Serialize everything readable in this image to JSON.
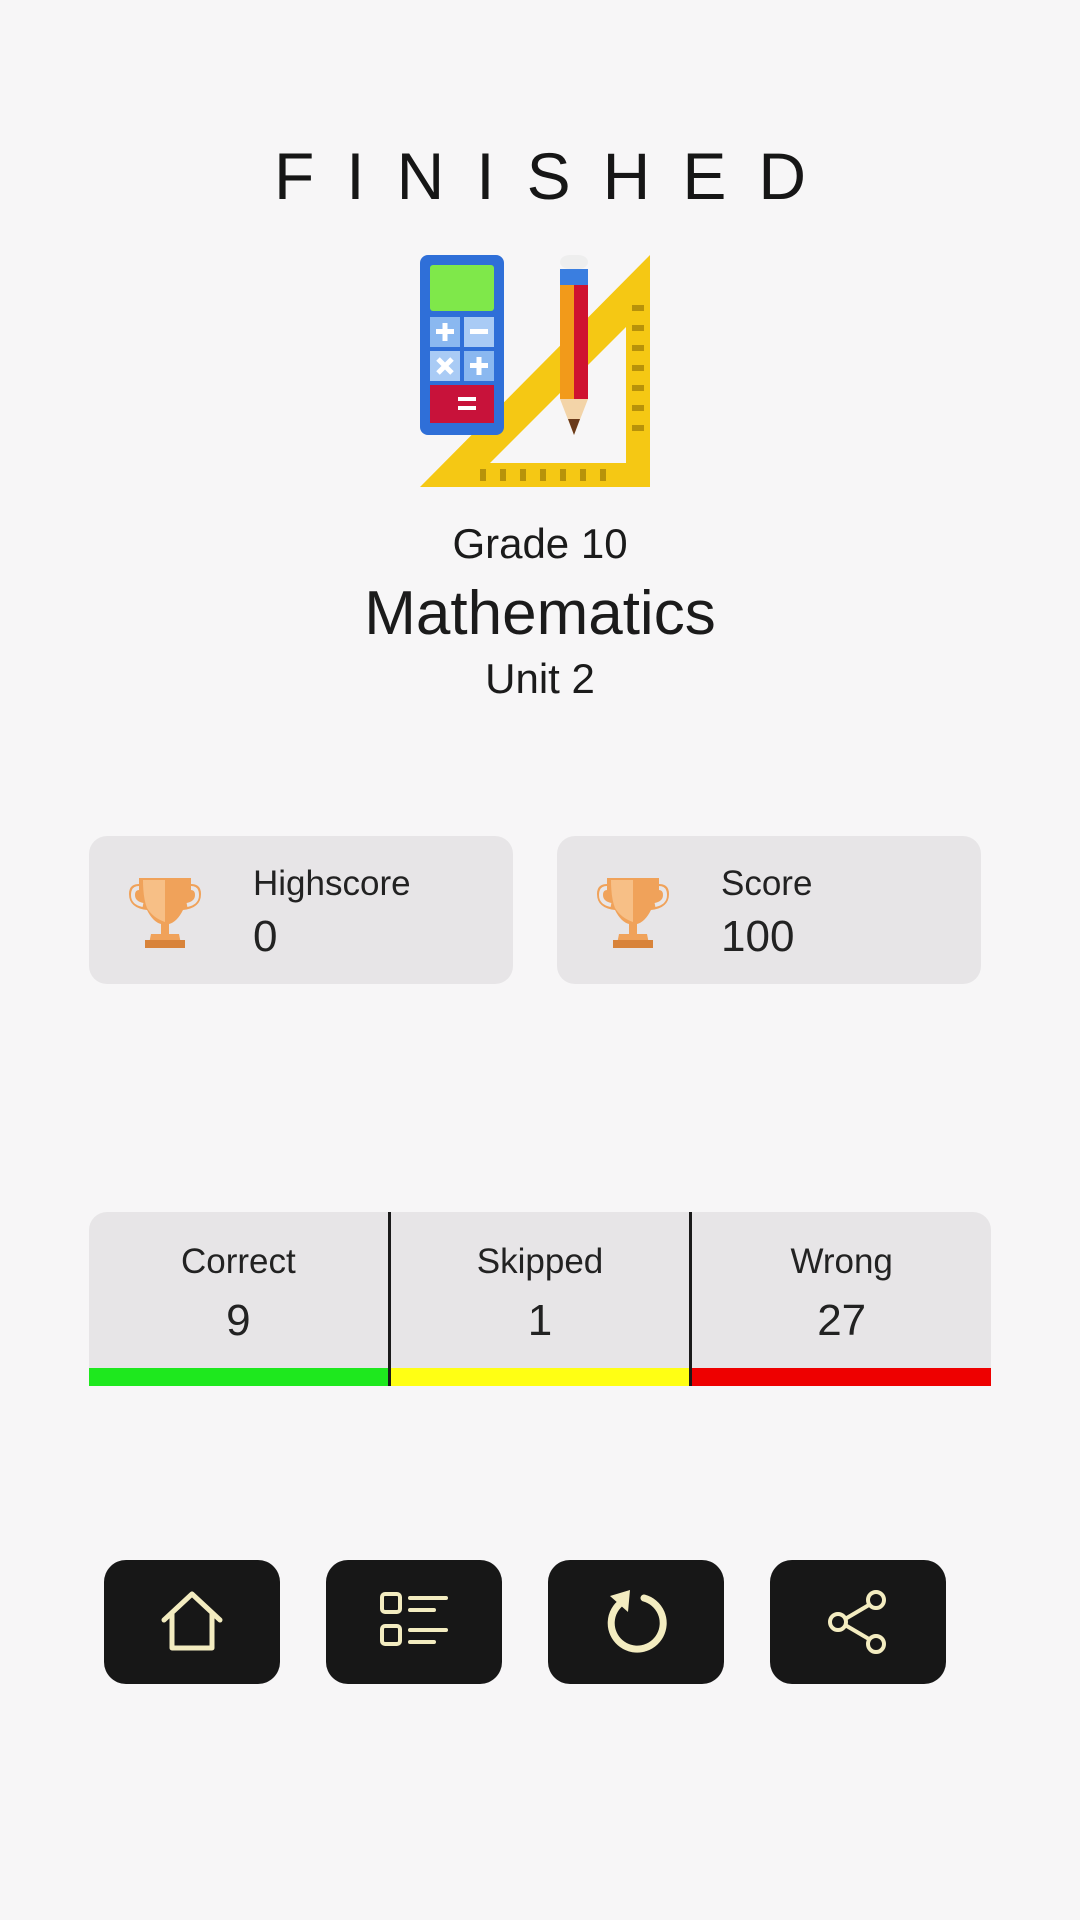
{
  "header": {
    "title": "FINISHED"
  },
  "quiz": {
    "grade_label": "Grade",
    "grade_value": "10",
    "subject": "Mathematics",
    "unit_label": "Unit",
    "unit_value": "2",
    "icon": "calculator-ruler-pencil-icon"
  },
  "scores": {
    "highscore": {
      "label": "Highscore",
      "value": "0",
      "icon": "trophy-icon"
    },
    "score": {
      "label": "Score",
      "value": "100",
      "icon": "trophy-icon"
    }
  },
  "stats": {
    "correct": {
      "label": "Correct",
      "value": "9",
      "color": "#1ee81e"
    },
    "skipped": {
      "label": "Skipped",
      "value": "1",
      "color": "#ffff14"
    },
    "wrong": {
      "label": "Wrong",
      "value": "27",
      "color": "#ee0000"
    }
  },
  "actions": [
    {
      "name": "home",
      "icon": "home-icon"
    },
    {
      "name": "review",
      "icon": "list-icon"
    },
    {
      "name": "retry",
      "icon": "refresh-icon"
    },
    {
      "name": "share",
      "icon": "share-icon"
    }
  ],
  "colors": {
    "background": "#f7f6f7",
    "card": "#e7e5e7",
    "button": "#171717",
    "button_icon": "#f3ecc0"
  }
}
